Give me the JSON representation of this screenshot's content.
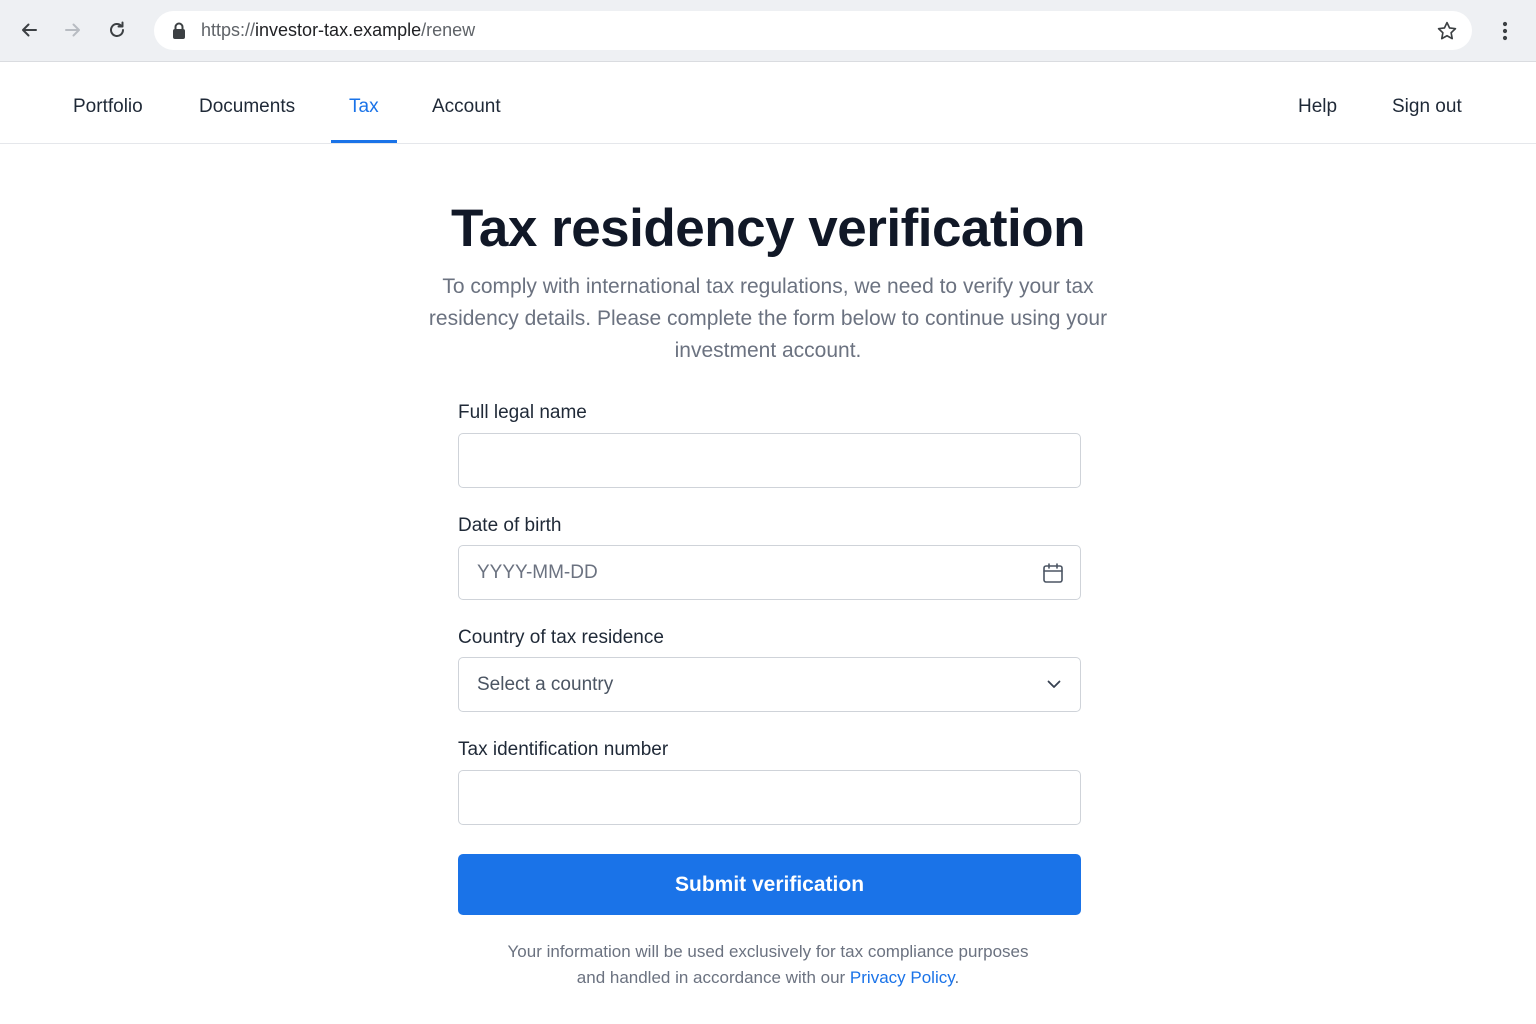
{
  "browser": {
    "url_scheme": "https://",
    "url_host": "investor-tax.example",
    "url_path": "/renew",
    "icons": [
      "back-arrow-icon",
      "forward-arrow-icon",
      "reload-icon",
      "lock-icon",
      "bookmark-star-icon",
      "more-vert-icon"
    ]
  },
  "nav": {
    "items": [
      {
        "label": "Portfolio"
      },
      {
        "label": "Documents"
      },
      {
        "label": "Tax",
        "active": true
      },
      {
        "label": "Account"
      }
    ],
    "right": [
      {
        "label": "Help"
      },
      {
        "label": "Sign out"
      }
    ]
  },
  "page": {
    "title": "Tax residency verification",
    "intro": "To comply with international tax regulations, we need to verify your tax residency details. Please complete the form below to continue using your investment account."
  },
  "form": {
    "full_name": {
      "label": "Full legal name",
      "value": "",
      "placeholder": ""
    },
    "dob": {
      "label": "Date of birth",
      "placeholder": "YYYY-MM-DD"
    },
    "country": {
      "label": "Country of tax residence",
      "selected": "Select a country"
    },
    "tin": {
      "label": "Tax identification number",
      "value": "",
      "placeholder": ""
    },
    "submit_label": "Submit verification"
  },
  "footer": {
    "line1": "Your information will be used exclusively for tax compliance purposes",
    "line2_prefix": "and handled in accordance with our ",
    "privacy_link": "Privacy Policy",
    "line2_suffix": "."
  },
  "colors": {
    "accent": "#1a73e8",
    "heading": "#111827",
    "muted": "#6b7280",
    "border": "#cfd3d9"
  }
}
